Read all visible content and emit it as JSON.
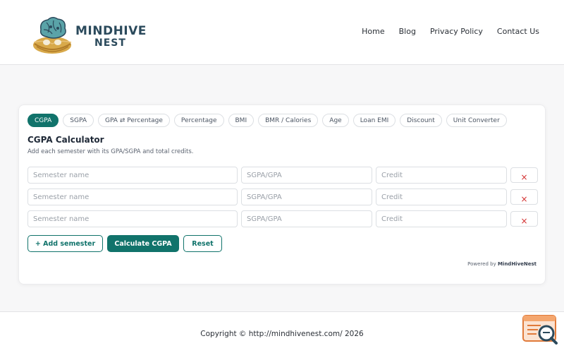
{
  "header": {
    "logo": {
      "line1": "MINDHIVE",
      "line2": "NEST"
    },
    "nav": [
      {
        "label": "Home"
      },
      {
        "label": "Blog"
      },
      {
        "label": "Privacy Policy"
      },
      {
        "label": "Contact Us"
      }
    ]
  },
  "tabs": [
    {
      "label": "CGPA",
      "active": true
    },
    {
      "label": "SGPA"
    },
    {
      "label": "GPA ⇄ Percentage"
    },
    {
      "label": "Percentage"
    },
    {
      "label": "BMI"
    },
    {
      "label": "BMR / Calories"
    },
    {
      "label": "Age"
    },
    {
      "label": "Loan EMI"
    },
    {
      "label": "Discount"
    },
    {
      "label": "Unit Converter"
    }
  ],
  "calculator": {
    "title": "CGPA Calculator",
    "subtitle": "Add each semester with its GPA/SGPA and total credits.",
    "rows": [
      {
        "name_placeholder": "Semester name",
        "gpa_placeholder": "SGPA/GPA",
        "credit_placeholder": "Credit",
        "delete_label": "×"
      },
      {
        "name_placeholder": "Semester name",
        "gpa_placeholder": "SGPA/GPA",
        "credit_placeholder": "Credit",
        "delete_label": "×"
      },
      {
        "name_placeholder": "Semester name",
        "gpa_placeholder": "SGPA/GPA",
        "credit_placeholder": "Credit",
        "delete_label": "×"
      }
    ],
    "add_label": "+ Add semester",
    "calculate_label": "Calculate CGPA",
    "reset_label": "Reset",
    "powered_prefix": "Powered by",
    "powered_brand": "MindHiveNest"
  },
  "footer": {
    "copyright": "Copyright © http://mindhivenest.com/ 2026"
  },
  "colors": {
    "accent": "#11736b",
    "delete": "#d32f2f",
    "logo_text": "#2b4a5c"
  },
  "icons": {
    "logo": "brain-nest-logo",
    "widget": "search-document-icon"
  }
}
